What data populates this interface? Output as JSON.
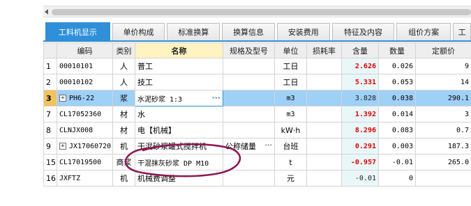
{
  "tabs": [
    {
      "label": "工料机显示",
      "active": true
    },
    {
      "label": "单价构成",
      "active": false
    },
    {
      "label": "标准换算",
      "active": false
    },
    {
      "label": "换算信息",
      "active": false
    },
    {
      "label": "安装费用",
      "active": false
    },
    {
      "label": "特征及内容",
      "active": false
    },
    {
      "label": "组价方案",
      "active": false
    },
    {
      "label": "工",
      "active": false
    }
  ],
  "columns": [
    "",
    "编码",
    "类别",
    "名称",
    "规格及型号",
    "单位",
    "损耗率",
    "含量",
    "数量",
    "定额价"
  ],
  "rows": [
    {
      "idx": "1",
      "code": "00010101",
      "category": "人",
      "name": "普工",
      "spec": "",
      "unit": "工日",
      "loss": "",
      "content": "2.626",
      "qty": "0.026",
      "price": "9"
    },
    {
      "idx": "2",
      "code": "00010102",
      "category": "人",
      "name": "技工",
      "spec": "",
      "unit": "工日",
      "loss": "",
      "content": "5.331",
      "qty": "0.053",
      "price": "14"
    },
    {
      "idx": "3",
      "code": "PH6-22",
      "category": "浆",
      "name": "水泥砂浆 1:3",
      "spec": "",
      "unit": "m3",
      "loss": "",
      "content": "3.828",
      "qty": "0.038",
      "price": "290.1"
    },
    {
      "idx": "7",
      "code": "CL17052360",
      "category": "材",
      "name": "水",
      "spec": "",
      "unit": "m3",
      "loss": "",
      "content": "1.392",
      "qty": "0.014",
      "price": "3"
    },
    {
      "idx": "8",
      "code": "CLNJX008",
      "category": "材",
      "name": "电【机械】",
      "spec": "",
      "unit": "kW·h",
      "loss": "",
      "content": "8.296",
      "qty": "0.083",
      "price": "0.7"
    },
    {
      "idx": "9",
      "code": "JX17060720",
      "category": "机",
      "name": "干混砂浆罐式搅拌机",
      "spec": "公称储量",
      "unit": "台班",
      "loss": "",
      "content": "0.291",
      "qty": "0.003",
      "price": "187.3"
    },
    {
      "idx": "15",
      "code": "CL17019500",
      "category": "商浆",
      "name": "干混抹灰砂浆 DP M10",
      "spec": "",
      "unit": "t",
      "loss": "",
      "content": "-0.957",
      "qty": "-0.01",
      "price": "265.0"
    },
    {
      "idx": "16",
      "code": "JXFTZ",
      "category": "机",
      "name": "机械费调整",
      "spec": "",
      "unit": "元",
      "loss": "",
      "content": "-0.01",
      "qty": "0",
      "price": ""
    }
  ],
  "colors": {
    "accent": "#2f8fd8",
    "selected_row": "#9fd0f6",
    "red_value": "#e00000",
    "annotation": "#8b1a55"
  }
}
